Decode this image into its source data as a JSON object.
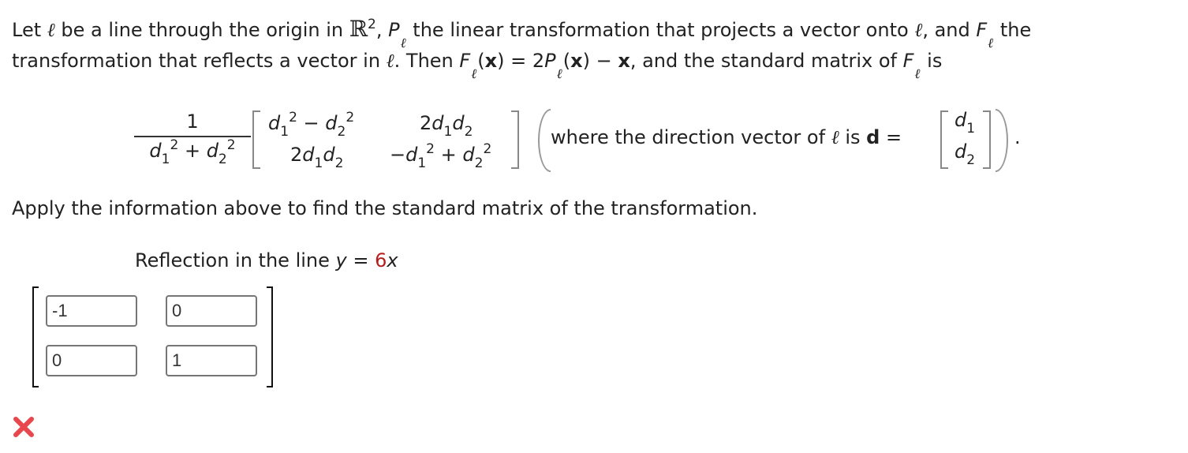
{
  "intro": {
    "line1": {
      "t1": "Let ",
      "ell": "ℓ",
      "t2": " be a line through the origin in ",
      "R": "ℝ",
      "R_sup": "2",
      "t3": ", ",
      "P": "P",
      "t4": " the linear transformation that projects a vector onto ",
      "t5": ", and ",
      "F": "F",
      "t6": " the"
    },
    "line2": {
      "t1": "transformation that reflects a vector in ",
      "t2": ". Then ",
      "F": "F",
      "paren_x": "(x)",
      "x_bold": "x",
      "eq": " = 2",
      "P": "P",
      "minus": " − ",
      "t3": ", and the standard matrix of ",
      "t4": " is",
      "open": "(",
      "close": ")"
    }
  },
  "formula": {
    "numerator": "1",
    "denominator": {
      "d": "d",
      "s1": "1",
      "s2": "2",
      "sq": "2",
      "plus": " + "
    },
    "matrix": {
      "a11": {
        "d": "d",
        "s1": "1",
        "s2": "2",
        "sq": "2",
        "op": " − "
      },
      "a12": {
        "two": "2",
        "d": "d",
        "s1": "1",
        "s2": "2"
      },
      "a21": {
        "two": "2",
        "d": "d",
        "s1": "1",
        "s2": "2"
      },
      "a22": {
        "neg": "−",
        "d": "d",
        "s1": "1",
        "s2": "2",
        "sq": "2",
        "op": " + "
      }
    },
    "where_text": "where the direction vector of ",
    "is_text": " is ",
    "d_bold": "d",
    "eq": " =",
    "vector": {
      "d": "d",
      "s1": "1",
      "s2": "2"
    },
    "period": "."
  },
  "instruction": "Apply the information above to find the standard matrix of the transformation.",
  "problem": {
    "label": "Reflection in the line ",
    "y": "y",
    "eq": " = ",
    "coef": "6",
    "x": "x",
    "coef_color": "#b51e1e"
  },
  "answer": {
    "cells": [
      "-1",
      "0",
      "0",
      "1"
    ],
    "status": "incorrect",
    "status_icon": "x-mark-icon",
    "status_color": "#e8474d"
  }
}
